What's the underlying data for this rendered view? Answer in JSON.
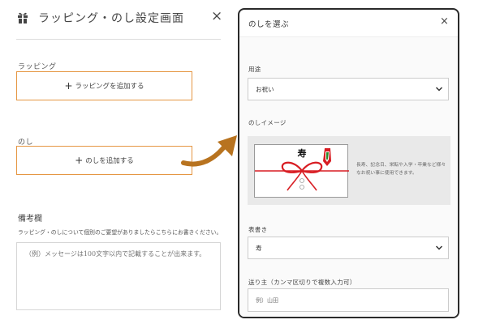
{
  "left": {
    "title": "ラッピング・のし設定画面",
    "close": "×",
    "wrapping_label": "ラッピング",
    "wrapping_add": "ラッピングを追加する",
    "noshi_label": "のし",
    "noshi_add": "のしを追加する",
    "plus": "+",
    "notes_title": "備考欄",
    "notes_description": "ラッピング・のしについて個別のご要望がありましたらこちらにお書きください。",
    "notes_placeholder": "（例）メッセージは100文字以内で記載することが出来ます。"
  },
  "modal": {
    "title": "のしを選ぶ",
    "close": "×",
    "purpose_label": "用途",
    "purpose_value": "お祝い",
    "image_label": "のしイメージ",
    "noshi_character": "寿",
    "image_note": "長寿、記念日、栄転や入学・卒業など様々なお祝い事に使用できます。",
    "omotegaki_label": "表書き",
    "omotegaki_value": "寿",
    "sender_label": "送り主（カンマ区切りで複数入力可）",
    "sender_placeholder": "例）山田"
  },
  "colors": {
    "accent_orange": "#e59642",
    "arrow_brown": "#b8731f",
    "noshi_red": "#d81c22"
  },
  "icons": {
    "gift": "gift-icon",
    "chevron": "chevron-down-icon",
    "arrow": "arrow-right-icon"
  }
}
